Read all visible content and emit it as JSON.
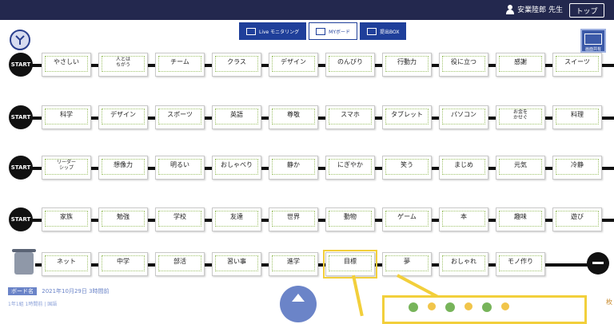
{
  "header": {
    "user_name": "安業陸郎 先生",
    "top_button": "トップ"
  },
  "tabs": [
    {
      "label": "Live モニタリング"
    },
    {
      "label": "MYボード"
    },
    {
      "label": "提出BOX"
    }
  ],
  "share_button": "画面共有",
  "start_label": "START",
  "rows": [
    [
      "やさしい",
      "人とは ちがう",
      "チーム",
      "クラス",
      "デザイン",
      "のんびり",
      "行動力",
      "役に立つ",
      "感謝",
      "スイーツ"
    ],
    [
      "科学",
      "デザイン",
      "スポーツ",
      "英語",
      "尊敬",
      "スマホ",
      "タブレット",
      "パソコン",
      "お金を かせぐ",
      "料理"
    ],
    [
      "リーダー シップ",
      "想像力",
      "明るい",
      "おしゃべり",
      "静か",
      "にぎやか",
      "笑う",
      "まじめ",
      "元気",
      "冷静"
    ],
    [
      "家族",
      "勉強",
      "学校",
      "友達",
      "世界",
      "動物",
      "ゲーム",
      "本",
      "趣味",
      "遊び"
    ],
    [
      "ネット",
      "中学",
      "部活",
      "習い事",
      "進学",
      "目標",
      "夢",
      "おしゃれ",
      "モノ作り"
    ]
  ],
  "status": {
    "badge": "ボード名",
    "date": "2021年10月29日 3時間前",
    "sub": "1年1組 1時間前 | 国語"
  },
  "count_label": "枚",
  "colors": {
    "header_bg": "#23284e",
    "tab_blue": "#1f3f9a",
    "highlight": "#f2cf3b",
    "frame_green": "#9fc36a"
  }
}
